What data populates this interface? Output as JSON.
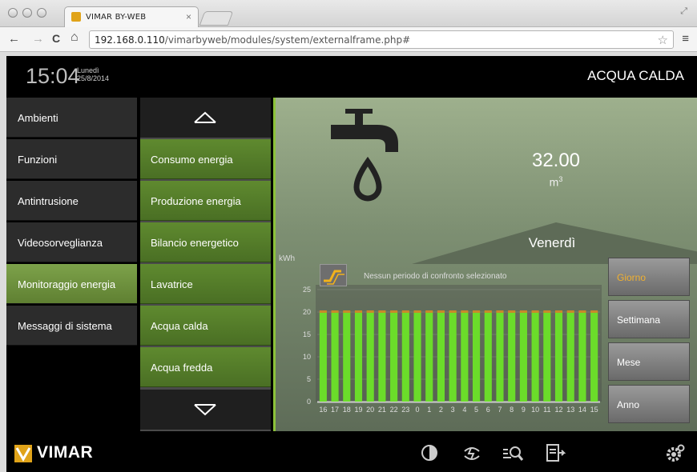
{
  "browser": {
    "tab_title": "VIMAR BY-WEB",
    "tab_close": "×",
    "url_host": "192.168.0.110",
    "url_path": "/vimarbyweb/modules/system/externalframe.php#",
    "nav_back": "←",
    "nav_forward": "→",
    "nav_reload": "C",
    "nav_home": "⌂",
    "star": "☆",
    "menu": "≡"
  },
  "header": {
    "time": "15:04",
    "weekday": "Lunedì",
    "date": "25/8/2014",
    "title": "ACQUA CALDA"
  },
  "menu": {
    "items": [
      {
        "label": "Ambienti"
      },
      {
        "label": "Funzioni"
      },
      {
        "label": "Antintrusione"
      },
      {
        "label": "Videosorveglianza"
      },
      {
        "label": "Monitoraggio energia"
      },
      {
        "label": "Messaggi di sistema"
      }
    ]
  },
  "submenu": {
    "items": [
      {
        "label": "Consumo energia"
      },
      {
        "label": "Produzione energia"
      },
      {
        "label": "Bilancio energetico"
      },
      {
        "label": "Lavatrice"
      },
      {
        "label": "Acqua calda"
      },
      {
        "label": "Acqua fredda"
      }
    ]
  },
  "content": {
    "value": "32.00",
    "unit_base": "m",
    "unit_exp": "3",
    "day": "Venerdì",
    "compare_text": "Nessun periodo di confronto selezionato"
  },
  "chart_data": {
    "type": "bar",
    "ylabel": "kWh",
    "ylim": [
      0,
      25
    ],
    "yticks": [
      "0",
      "5",
      "10",
      "15",
      "20",
      "25"
    ],
    "categories": [
      "16",
      "17",
      "18",
      "19",
      "20",
      "21",
      "22",
      "23",
      "0",
      "1",
      "2",
      "3",
      "4",
      "5",
      "6",
      "7",
      "8",
      "9",
      "10",
      "11",
      "12",
      "13",
      "14",
      "15"
    ],
    "values": [
      20,
      20,
      20,
      20,
      20,
      20,
      20,
      20,
      20,
      20,
      20,
      20,
      20,
      20,
      20,
      20,
      20,
      20,
      20,
      20,
      20,
      20,
      20,
      20
    ],
    "bar_color": "#6bdc2a",
    "bar_cap_color": "#c8892a"
  },
  "periods": [
    {
      "label": "Giorno",
      "active": true
    },
    {
      "label": "Settimana",
      "active": false
    },
    {
      "label": "Mese",
      "active": false
    },
    {
      "label": "Anno",
      "active": false
    }
  ],
  "footer": {
    "brand": "VIMAR"
  },
  "colors": {
    "accent_green": "#6a9438",
    "active_period": "#f0b030",
    "brand_yellow": "#e0a319"
  }
}
